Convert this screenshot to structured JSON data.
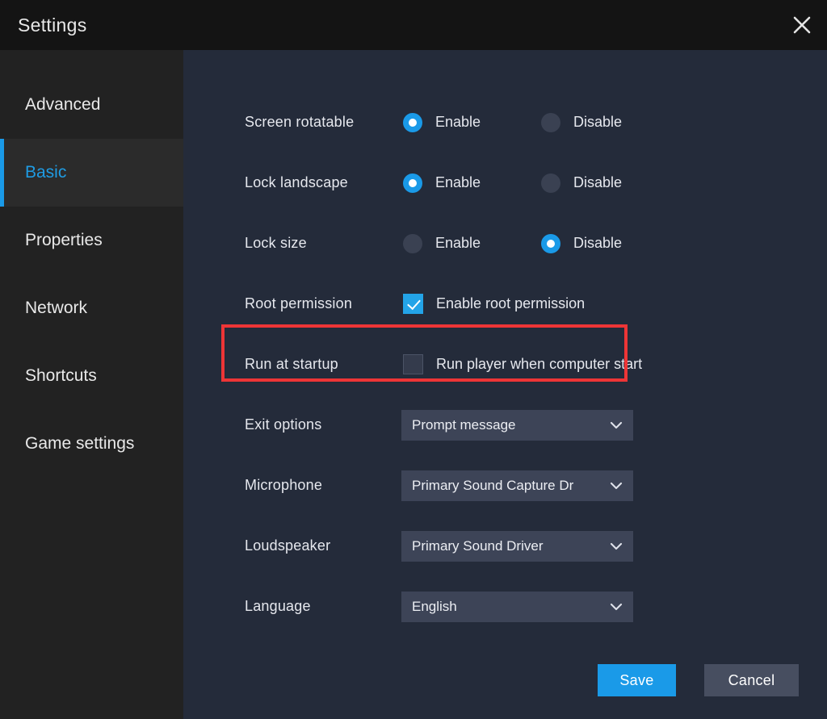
{
  "window": {
    "title": "Settings",
    "close_icon": "close-icon"
  },
  "colors": {
    "accent": "#1a9ae8",
    "highlight": "#ee3536",
    "titlebar_bg": "#141414",
    "sidebar_bg": "#222222",
    "content_bg": "#242b3a",
    "dropdown_bg": "#3d4457",
    "secondary_button_bg": "#474e60"
  },
  "sidebar": {
    "items": [
      {
        "label": "Advanced",
        "active": false
      },
      {
        "label": "Basic",
        "active": true
      },
      {
        "label": "Properties",
        "active": false
      },
      {
        "label": "Network",
        "active": false
      },
      {
        "label": "Shortcuts",
        "active": false
      },
      {
        "label": "Game settings",
        "active": false
      }
    ]
  },
  "settings": {
    "radio_rows": [
      {
        "label": "Screen rotatable",
        "options": [
          {
            "label": "Enable",
            "selected": true
          },
          {
            "label": "Disable",
            "selected": false
          }
        ]
      },
      {
        "label": "Lock landscape",
        "options": [
          {
            "label": "Enable",
            "selected": true
          },
          {
            "label": "Disable",
            "selected": false
          }
        ]
      },
      {
        "label": "Lock size",
        "options": [
          {
            "label": "Enable",
            "selected": false
          },
          {
            "label": "Disable",
            "selected": true
          }
        ]
      }
    ],
    "checkbox_rows": [
      {
        "label": "Root permission",
        "checkbox_label": "Enable root permission",
        "checked": true,
        "highlighted": true
      },
      {
        "label": "Run at startup",
        "checkbox_label": "Run player when computer start",
        "checked": false,
        "highlighted": false
      }
    ],
    "dropdown_rows": [
      {
        "label": "Exit options",
        "value": "Prompt message"
      },
      {
        "label": "Microphone",
        "value": "Primary Sound Capture Dr"
      },
      {
        "label": "Loudspeaker",
        "value": "Primary Sound Driver"
      },
      {
        "label": "Language",
        "value": "English"
      }
    ]
  },
  "footer": {
    "save_label": "Save",
    "cancel_label": "Cancel"
  }
}
